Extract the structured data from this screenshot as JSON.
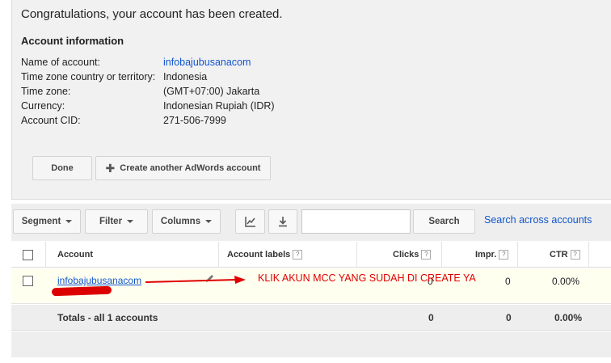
{
  "confirmation": {
    "message": "Congratulations, your account has been created.",
    "section_title": "Account information",
    "fields": [
      {
        "label": "Name of account:",
        "value": "infobajubusanacom"
      },
      {
        "label": "Time zone country or territory:",
        "value": "Indonesia"
      },
      {
        "label": "Time zone:",
        "value": "(GMT+07:00) Jakarta"
      },
      {
        "label": "Currency:",
        "value": "Indonesian Rupiah (IDR)"
      },
      {
        "label": "Account CID:",
        "value": "271-506-7999"
      }
    ],
    "done_label": "Done",
    "create_another_label": "Create another AdWords account"
  },
  "toolbar": {
    "segment_label": "Segment",
    "filter_label": "Filter",
    "columns_label": "Columns",
    "chart_icon": "line-chart-icon",
    "download_icon": "download-icon",
    "search_value": "",
    "search_label": "Search",
    "search_across_label": "Search across accounts"
  },
  "table": {
    "headers": {
      "account": "Account",
      "labels": "Account labels",
      "clicks": "Clicks",
      "impr": "Impr.",
      "ctr": "CTR",
      "help": "?"
    },
    "rows": [
      {
        "account": "infobajubusanacom",
        "clicks": "0",
        "impr": "0",
        "ctr": "0.00%"
      }
    ],
    "totals": {
      "label": "Totals - all 1 accounts",
      "clicks": "0",
      "impr": "0",
      "ctr": "0.00%"
    }
  },
  "annotation": {
    "text": "KLIK AKUN MCC YANG SUDAH DI CREATE YA",
    "color": "#e00000"
  },
  "colors": {
    "link": "#1155cc",
    "panel": "#f1f1f1"
  }
}
